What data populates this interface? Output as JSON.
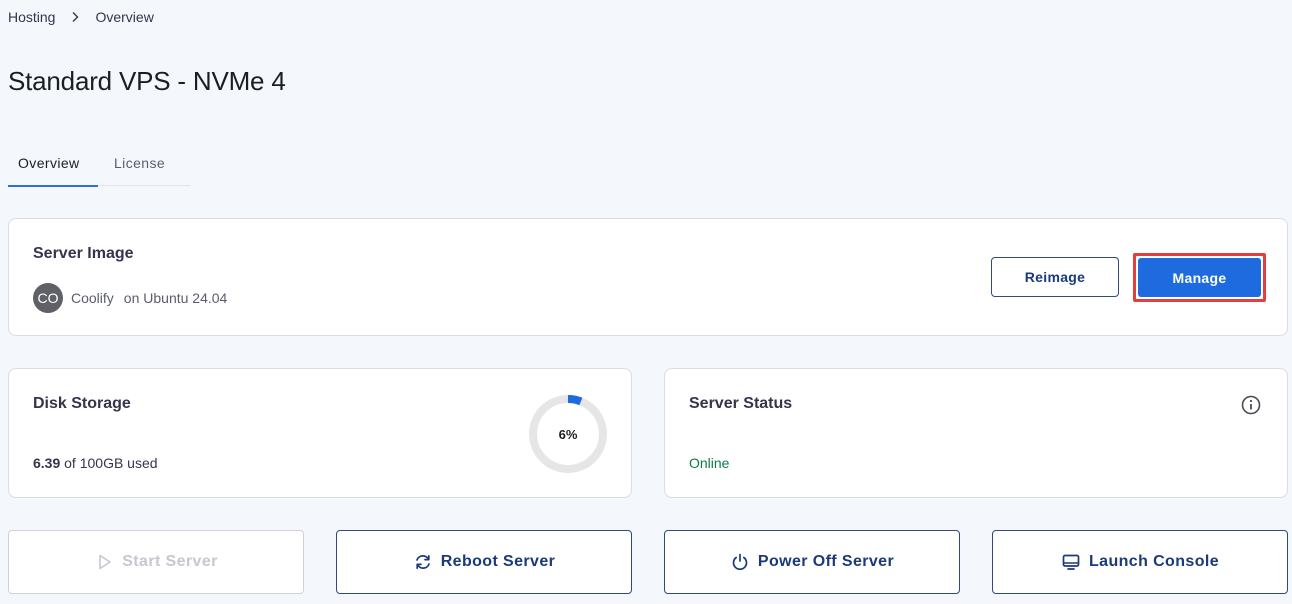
{
  "breadcrumb": {
    "items": [
      "Hosting",
      "Overview"
    ]
  },
  "page_title": "Standard VPS - NVMe 4",
  "tabs": [
    {
      "label": "Overview",
      "active": true
    },
    {
      "label": "License",
      "active": false
    }
  ],
  "server_image": {
    "title": "Server Image",
    "avatar_initials": "CO",
    "app_name": "Coolify",
    "os_version": "on Ubuntu 24.04",
    "reimage_label": "Reimage",
    "manage_label": "Manage"
  },
  "disk_storage": {
    "title": "Disk Storage",
    "used_value": "6.39",
    "used_suffix": "of 100GB used",
    "percent": 6,
    "percent_label": "6%"
  },
  "server_status": {
    "title": "Server Status",
    "status": "Online"
  },
  "actions": {
    "start_label": "Start Server",
    "reboot_label": "Reboot Server",
    "power_off_label": "Power Off Server",
    "console_label": "Launch Console"
  },
  "colors": {
    "accent": "#1e6be0",
    "highlight_border": "#e2403d",
    "status_online": "#0f7b4a",
    "button_text": "#1a3a7a",
    "donut_track": "#e6e6e6",
    "donut_fill": "#1e6be0"
  },
  "icons": {
    "breadcrumb_separator": "chevron-right-icon",
    "info": "info-icon",
    "start": "play-icon",
    "reboot": "refresh-icon",
    "power_off": "power-icon",
    "console": "monitor-icon"
  }
}
